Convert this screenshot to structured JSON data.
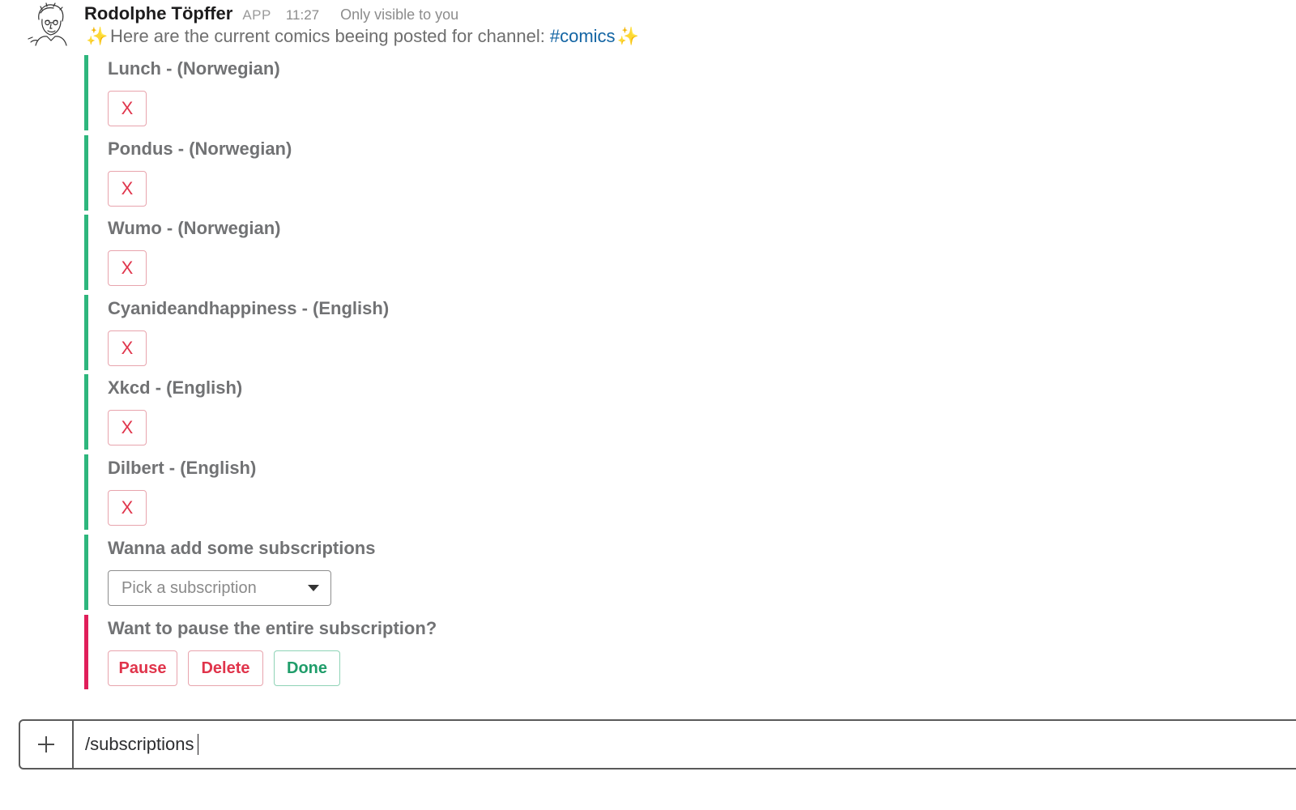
{
  "message": {
    "sender_name": "Rodolphe Töpffer",
    "app_badge": "APP",
    "timestamp": "11:27",
    "visibility_note": "Only visible to you",
    "avatar_icon": "sketch-portrait-avatar",
    "intro_text": "Here are the current comics beeing posted for channel:",
    "channel_link": "#comics",
    "sparkle_icon": "✨"
  },
  "subscriptions": [
    {
      "title": "Lunch - (Norwegian)",
      "remove_label": "X"
    },
    {
      "title": "Pondus - (Norwegian)",
      "remove_label": "X"
    },
    {
      "title": "Wumo - (Norwegian)",
      "remove_label": "X"
    },
    {
      "title": "Cyanideandhappiness - (English)",
      "remove_label": "X"
    },
    {
      "title": "Xkcd - (English)",
      "remove_label": "X"
    },
    {
      "title": "Dilbert - (English)",
      "remove_label": "X"
    }
  ],
  "add_subscription": {
    "title": "Wanna add some subscriptions",
    "select_placeholder": "Pick a subscription"
  },
  "pause_section": {
    "title": "Want to pause the entire subscription?",
    "pause_label": "Pause",
    "delete_label": "Delete",
    "done_label": "Done"
  },
  "composer": {
    "text": "/subscriptions",
    "plus_icon": "plus-icon"
  },
  "colors": {
    "good": "#2eb67d",
    "danger": "#e01e5a",
    "link": "#1264a3",
    "button_red": "#e0344b",
    "button_green": "#1f9d6a",
    "sparkle": "#f5b90f"
  }
}
